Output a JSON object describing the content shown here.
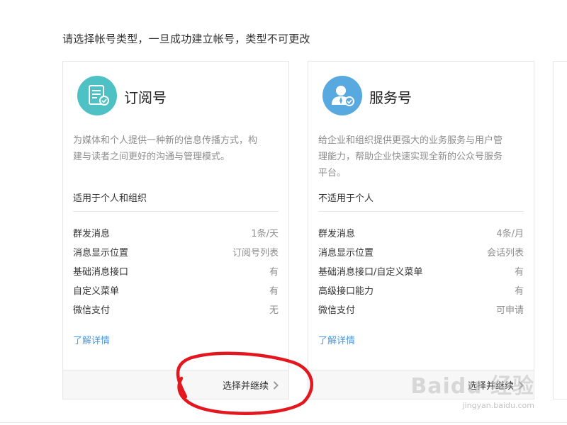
{
  "header": {
    "title": "请选择帐号类型，一旦成功建立帐号，类型不可更改"
  },
  "cards": [
    {
      "title": "订阅号",
      "icon": "subscription-document-icon",
      "icon_color": "#4ec1c4",
      "desc_lines": [
        "为媒体和个人提供一种新的信息传播方式，构",
        "建与读者之间更好的沟通与管理模式。"
      ],
      "scope": "适用于个人和组织",
      "features": [
        {
          "name": "群发消息",
          "value": "1条/天"
        },
        {
          "name": "消息显示位置",
          "value": "订阅号列表"
        },
        {
          "name": "基础消息接口",
          "value": "有"
        },
        {
          "name": "自定义菜单",
          "value": "有"
        },
        {
          "name": "微信支付",
          "value": "无"
        }
      ],
      "detail_link": "了解详情",
      "action": "选择并继续"
    },
    {
      "title": "服务号",
      "icon": "service-person-icon",
      "icon_color": "#58a9e0",
      "desc_lines": [
        "给企业和组织提供更强大的业务服务与用户管",
        "理能力，帮助企业快速实现全新的公众号服务",
        "平台。"
      ],
      "scope": "不适用于个人",
      "features": [
        {
          "name": "群发消息",
          "value": "4条/月"
        },
        {
          "name": "消息显示位置",
          "value": "会话列表"
        },
        {
          "name": "基础消息接口/自定义菜单",
          "value": "有"
        },
        {
          "name": "高级接口能力",
          "value": "有"
        },
        {
          "name": "微信支付",
          "value": "可申请"
        }
      ],
      "detail_link": "了解详情",
      "action": "选择并继续"
    }
  ],
  "colors": {
    "link": "#459ae9",
    "annotation_circle": "#e3171d"
  },
  "watermark": {
    "brand": "Baidu 经验",
    "url": "jingyan.baidu.com"
  }
}
